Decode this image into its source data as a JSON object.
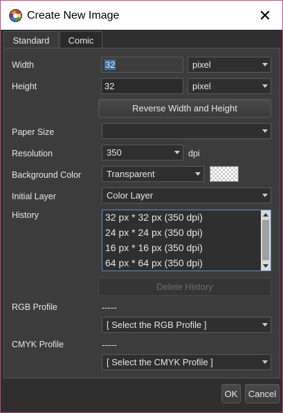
{
  "window": {
    "title": "Create New Image",
    "close_glyph": "✕"
  },
  "tabs": [
    {
      "label": "Standard",
      "active": true
    },
    {
      "label": "Comic",
      "active": false
    }
  ],
  "form": {
    "width": {
      "label": "Width",
      "value": "32",
      "unit": "pixel"
    },
    "height": {
      "label": "Height",
      "value": "32",
      "unit": "pixel"
    },
    "reverse_button": "Reverse Width and Height",
    "paper_size": {
      "label": "Paper Size",
      "value": ""
    },
    "resolution": {
      "label": "Resolution",
      "value": "350",
      "unit": "dpi"
    },
    "background_color": {
      "label": "Background Color",
      "value": "Transparent"
    },
    "initial_layer": {
      "label": "Initial Layer",
      "value": "Color Layer"
    },
    "history": {
      "label": "History",
      "items": [
        "32 px * 32 px (350 dpi)",
        "24 px * 24 px (350 dpi)",
        "16 px * 16 px (350 dpi)",
        "64 px * 64 px (350 dpi)"
      ],
      "delete_button": "Delete History"
    },
    "rgb_profile": {
      "label": "RGB Profile",
      "current": "-----",
      "select": "[ Select the RGB Profile ]"
    },
    "cmyk_profile": {
      "label": "CMYK Profile",
      "current": "-----",
      "select": "[ Select the CMYK Profile ]"
    }
  },
  "footer": {
    "ok": "OK",
    "cancel": "Cancel"
  },
  "colors": {
    "accent_border": "#c24a7c",
    "panel_bg": "#3c3c3c",
    "selection": "#3a6ea5",
    "history_border": "#5b8fd0"
  }
}
